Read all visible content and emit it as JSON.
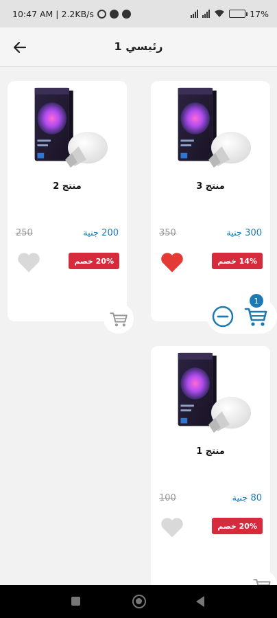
{
  "status_bar": {
    "time_speed": "10:47 AM | 2.2KB/s",
    "battery": "17%",
    "battery_level": 0.17
  },
  "header": {
    "title": "رئيسي 1",
    "back_icon": "arrow-left-icon"
  },
  "products": [
    {
      "name": "منتج 3",
      "price": "300 جنية",
      "old_price": "350",
      "discount": "14% خصم",
      "favorite": true,
      "in_cart_qty": "1"
    },
    {
      "name": "منتج 2",
      "price": "200 جنية",
      "old_price": "250",
      "discount": "20% خصم",
      "favorite": false
    },
    {
      "name": "منتج 1",
      "price": "80 جنية",
      "old_price": "100",
      "discount": "20% خصم",
      "favorite": false
    }
  ],
  "colors": {
    "accent": "#1c79b3",
    "discount_bg": "#d52b3c",
    "heart_active": "#e53935",
    "heart_inactive": "#d9d9d9"
  }
}
